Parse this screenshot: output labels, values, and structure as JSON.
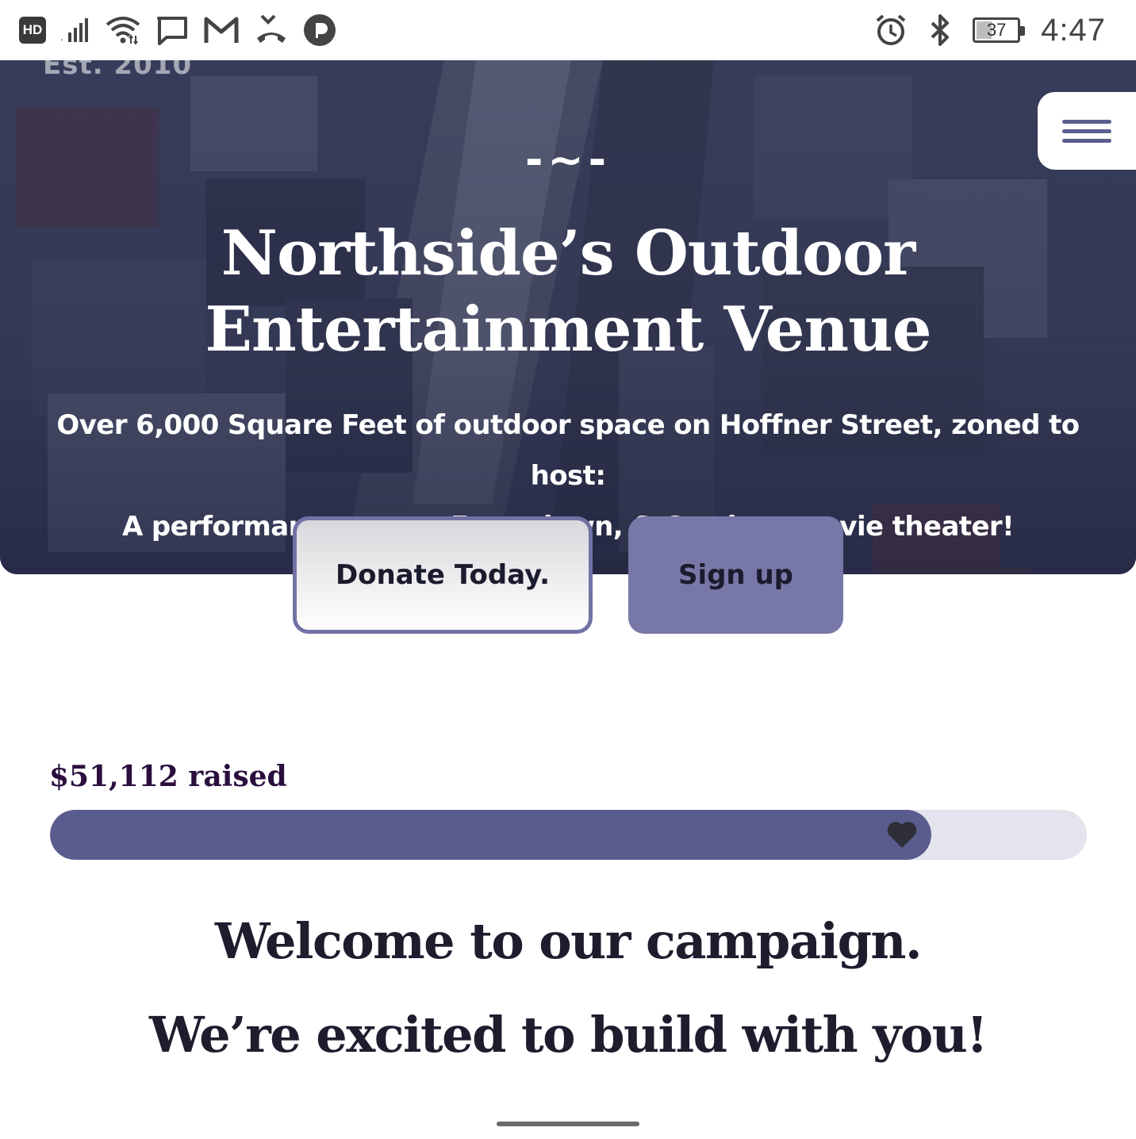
{
  "status_bar": {
    "left_icons": [
      "hd-badge",
      "signal-icon",
      "wifi-icon",
      "message-icon",
      "gmail-icon",
      "missed-call-icon",
      "pandora-icon"
    ],
    "hd_label": "HD",
    "right_icons": [
      "alarm-icon",
      "bluetooth-icon",
      "battery-icon"
    ],
    "battery_level": "37",
    "battery_fraction": 0.37,
    "time": "4:47"
  },
  "hero": {
    "est_label": "Est. 2010",
    "divider": "-~-",
    "title_line1": "Northside’s Outdoor",
    "title_line2": "Entertainment Venue",
    "subtitle_line1": "Over 6,000 Square Feet of outdoor space on Hoffner Street, zoned to host:",
    "subtitle_line2": "A performance stage, Event lawn, & Outdoor movie theater!",
    "menu_icon": "hamburger-menu-icon"
  },
  "buttons": {
    "donate_label": "Donate Today.",
    "signup_label": "Sign up"
  },
  "campaign": {
    "raised_label": "$51,112 raised",
    "progress_fraction": 0.85,
    "progress_icon": "heart-icon",
    "welcome_line1": "Welcome to our campaign.",
    "welcome_line2": "We’re excited to build with you!"
  },
  "colors": {
    "accent": "#5b5c8e",
    "button_signup": "#7878a8",
    "button_donate_border": "#7272a6",
    "hero_overlay": "#2f3553",
    "raised_text": "#2a0f3e",
    "heading_text": "#1d1d2e"
  }
}
